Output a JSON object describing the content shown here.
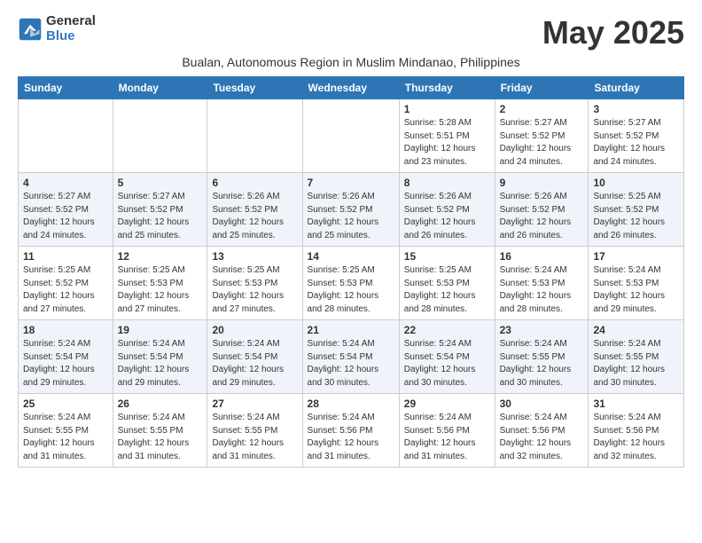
{
  "logo": {
    "general": "General",
    "blue": "Blue"
  },
  "title": "May 2025",
  "subtitle": "Bualan, Autonomous Region in Muslim Mindanao, Philippines",
  "days_of_week": [
    "Sunday",
    "Monday",
    "Tuesday",
    "Wednesday",
    "Thursday",
    "Friday",
    "Saturday"
  ],
  "weeks": [
    [
      {
        "day": "",
        "info": ""
      },
      {
        "day": "",
        "info": ""
      },
      {
        "day": "",
        "info": ""
      },
      {
        "day": "",
        "info": ""
      },
      {
        "day": "1",
        "info": "Sunrise: 5:28 AM\nSunset: 5:51 PM\nDaylight: 12 hours\nand 23 minutes."
      },
      {
        "day": "2",
        "info": "Sunrise: 5:27 AM\nSunset: 5:52 PM\nDaylight: 12 hours\nand 24 minutes."
      },
      {
        "day": "3",
        "info": "Sunrise: 5:27 AM\nSunset: 5:52 PM\nDaylight: 12 hours\nand 24 minutes."
      }
    ],
    [
      {
        "day": "4",
        "info": "Sunrise: 5:27 AM\nSunset: 5:52 PM\nDaylight: 12 hours\nand 24 minutes."
      },
      {
        "day": "5",
        "info": "Sunrise: 5:27 AM\nSunset: 5:52 PM\nDaylight: 12 hours\nand 25 minutes."
      },
      {
        "day": "6",
        "info": "Sunrise: 5:26 AM\nSunset: 5:52 PM\nDaylight: 12 hours\nand 25 minutes."
      },
      {
        "day": "7",
        "info": "Sunrise: 5:26 AM\nSunset: 5:52 PM\nDaylight: 12 hours\nand 25 minutes."
      },
      {
        "day": "8",
        "info": "Sunrise: 5:26 AM\nSunset: 5:52 PM\nDaylight: 12 hours\nand 26 minutes."
      },
      {
        "day": "9",
        "info": "Sunrise: 5:26 AM\nSunset: 5:52 PM\nDaylight: 12 hours\nand 26 minutes."
      },
      {
        "day": "10",
        "info": "Sunrise: 5:25 AM\nSunset: 5:52 PM\nDaylight: 12 hours\nand 26 minutes."
      }
    ],
    [
      {
        "day": "11",
        "info": "Sunrise: 5:25 AM\nSunset: 5:52 PM\nDaylight: 12 hours\nand 27 minutes."
      },
      {
        "day": "12",
        "info": "Sunrise: 5:25 AM\nSunset: 5:53 PM\nDaylight: 12 hours\nand 27 minutes."
      },
      {
        "day": "13",
        "info": "Sunrise: 5:25 AM\nSunset: 5:53 PM\nDaylight: 12 hours\nand 27 minutes."
      },
      {
        "day": "14",
        "info": "Sunrise: 5:25 AM\nSunset: 5:53 PM\nDaylight: 12 hours\nand 28 minutes."
      },
      {
        "day": "15",
        "info": "Sunrise: 5:25 AM\nSunset: 5:53 PM\nDaylight: 12 hours\nand 28 minutes."
      },
      {
        "day": "16",
        "info": "Sunrise: 5:24 AM\nSunset: 5:53 PM\nDaylight: 12 hours\nand 28 minutes."
      },
      {
        "day": "17",
        "info": "Sunrise: 5:24 AM\nSunset: 5:53 PM\nDaylight: 12 hours\nand 29 minutes."
      }
    ],
    [
      {
        "day": "18",
        "info": "Sunrise: 5:24 AM\nSunset: 5:54 PM\nDaylight: 12 hours\nand 29 minutes."
      },
      {
        "day": "19",
        "info": "Sunrise: 5:24 AM\nSunset: 5:54 PM\nDaylight: 12 hours\nand 29 minutes."
      },
      {
        "day": "20",
        "info": "Sunrise: 5:24 AM\nSunset: 5:54 PM\nDaylight: 12 hours\nand 29 minutes."
      },
      {
        "day": "21",
        "info": "Sunrise: 5:24 AM\nSunset: 5:54 PM\nDaylight: 12 hours\nand 30 minutes."
      },
      {
        "day": "22",
        "info": "Sunrise: 5:24 AM\nSunset: 5:54 PM\nDaylight: 12 hours\nand 30 minutes."
      },
      {
        "day": "23",
        "info": "Sunrise: 5:24 AM\nSunset: 5:55 PM\nDaylight: 12 hours\nand 30 minutes."
      },
      {
        "day": "24",
        "info": "Sunrise: 5:24 AM\nSunset: 5:55 PM\nDaylight: 12 hours\nand 30 minutes."
      }
    ],
    [
      {
        "day": "25",
        "info": "Sunrise: 5:24 AM\nSunset: 5:55 PM\nDaylight: 12 hours\nand 31 minutes."
      },
      {
        "day": "26",
        "info": "Sunrise: 5:24 AM\nSunset: 5:55 PM\nDaylight: 12 hours\nand 31 minutes."
      },
      {
        "day": "27",
        "info": "Sunrise: 5:24 AM\nSunset: 5:55 PM\nDaylight: 12 hours\nand 31 minutes."
      },
      {
        "day": "28",
        "info": "Sunrise: 5:24 AM\nSunset: 5:56 PM\nDaylight: 12 hours\nand 31 minutes."
      },
      {
        "day": "29",
        "info": "Sunrise: 5:24 AM\nSunset: 5:56 PM\nDaylight: 12 hours\nand 31 minutes."
      },
      {
        "day": "30",
        "info": "Sunrise: 5:24 AM\nSunset: 5:56 PM\nDaylight: 12 hours\nand 32 minutes."
      },
      {
        "day": "31",
        "info": "Sunrise: 5:24 AM\nSunset: 5:56 PM\nDaylight: 12 hours\nand 32 minutes."
      }
    ]
  ]
}
